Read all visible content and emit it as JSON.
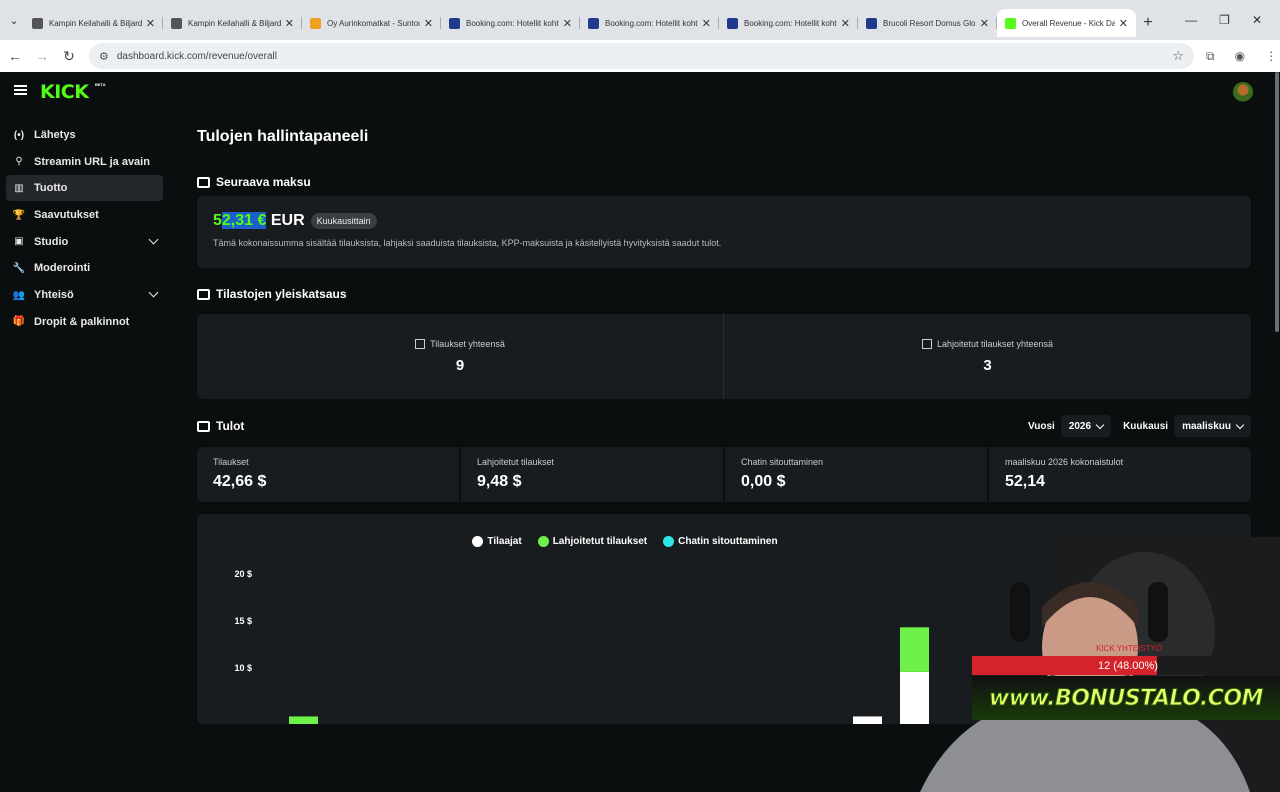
{
  "browser": {
    "tabs": [
      {
        "title": "Kampin Keilahalli & Biljard",
        "fav": "#555"
      },
      {
        "title": "Kampin Keilahalli & Biljard",
        "fav": "#555"
      },
      {
        "title": "Oy Aurinkomatkat - Suntours",
        "fav": "#f0a020"
      },
      {
        "title": "Booking.com: Hotellit kohteessa",
        "fav": "#1f3a8a"
      },
      {
        "title": "Booking.com: Hotellit kohteessa",
        "fav": "#1f3a8a"
      },
      {
        "title": "Booking.com: Hotellit kohteessa",
        "fav": "#1f3a8a"
      },
      {
        "title": "Brucoli Resort Domus Gloria",
        "fav": "#1f3a8a"
      },
      {
        "title": "Overall Revenue - Kick Dashboard",
        "fav": "#53fc18"
      }
    ],
    "url": "dashboard.kick.com/revenue/overall"
  },
  "app": {
    "logo": "KICK",
    "logo_badge": "BETA"
  },
  "sidebar": {
    "items": [
      {
        "label": "Lähetys",
        "icon": "broadcast-icon",
        "glyph": "(•)"
      },
      {
        "label": "Streamin URL ja avain",
        "icon": "link-icon",
        "glyph": "⚲"
      },
      {
        "label": "Tuotto",
        "icon": "chart-icon",
        "glyph": "▥"
      },
      {
        "label": "Saavutukset",
        "icon": "trophy-icon",
        "glyph": "🏆"
      },
      {
        "label": "Studio",
        "icon": "studio-icon",
        "glyph": "▣"
      },
      {
        "label": "Moderointi",
        "icon": "wrench-icon",
        "glyph": "🔧"
      },
      {
        "label": "Yhteisö",
        "icon": "community-icon",
        "glyph": "👥"
      },
      {
        "label": "Dropit & palkinnot",
        "icon": "gift-icon",
        "glyph": "🎁"
      }
    ]
  },
  "main": {
    "title": "Tulojen hallintapaneeli",
    "next_payment": {
      "heading": "Seuraava maksu",
      "amount_prefix": "5",
      "amount_selected": "2,31 €",
      "currency": "EUR",
      "frequency": "Kuukausittain",
      "description": "Tämä kokonaissumma sisältää tilauksista, lahjaksi saaduista tilauksista, KPP-maksuista ja käsitellyistä hyvityksistä saadut tulot."
    },
    "stats": {
      "heading": "Tilastojen yleiskatsaus",
      "items": [
        {
          "label": "Tilaukset yhteensä",
          "value": "9"
        },
        {
          "label": "Lahjoitetut tilaukset yhteensä",
          "value": "3"
        }
      ]
    },
    "revenue": {
      "heading": "Tulot",
      "year_label": "Vuosi",
      "year_value": "2026",
      "month_label": "Kuukausi",
      "month_value": "maaliskuu",
      "cells": [
        {
          "label": "Tilaukset",
          "value": "42,66 $"
        },
        {
          "label": "Lahjoitetut tilaukset",
          "value": "9,48 $"
        },
        {
          "label": "Chatin sitouttaminen",
          "value": "0,00 $"
        },
        {
          "label": "maaliskuu 2026 kokonaistulot",
          "value": "52,14"
        }
      ]
    }
  },
  "chart_data": {
    "type": "bar",
    "stacked": true,
    "series": [
      {
        "name": "Tilaajat",
        "color": "#ffffff",
        "values": [
          0,
          0,
          0,
          0,
          0,
          0,
          0,
          0,
          0,
          0,
          0,
          0,
          4.74,
          9.48,
          0,
          4.74
        ]
      },
      {
        "name": "Lahjoitetut tilaukset",
        "color": "#6ef24a",
        "values": [
          4.74,
          0,
          0,
          0,
          0,
          0,
          0,
          0,
          0,
          0,
          0,
          0,
          0,
          4.74,
          0,
          0
        ]
      },
      {
        "name": "Chatin sitouttaminen",
        "color": "#2ee6e6",
        "values": [
          0,
          0,
          0,
          0,
          0,
          0,
          0,
          0,
          0,
          0,
          0,
          0,
          0,
          0,
          0,
          0
        ]
      }
    ],
    "y_ticks": [
      "20 $",
      "15 $",
      "10 $"
    ],
    "y_tick_values": [
      20,
      15,
      10
    ],
    "ylim": [
      0,
      20
    ],
    "grid": false,
    "legend_position": "top-center"
  },
  "overlay": {
    "bar_heading": "KICK YHTEISTYÖ",
    "bar_text": "12 (48.00%)",
    "bar_fraction": 0.6,
    "brand_text": "www.BONUSTALO.COM"
  }
}
